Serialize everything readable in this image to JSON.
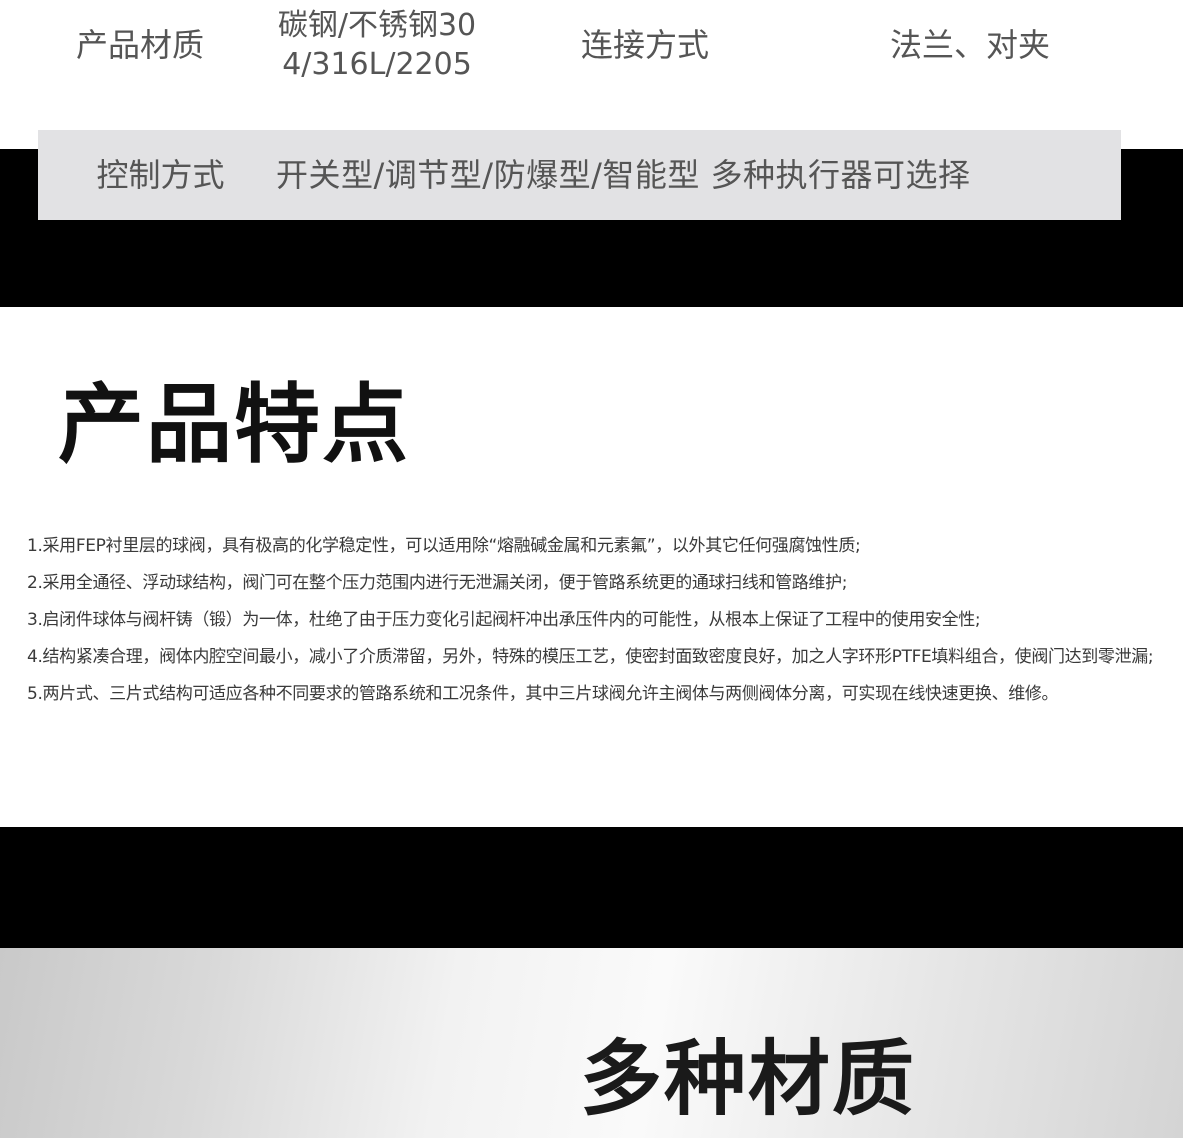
{
  "spec_table": {
    "material_label": "产品材质",
    "material_value": "碳钢/不锈钢304/316L/2205",
    "connection_label": "连接方式",
    "connection_value": "法兰、对夹",
    "control_label": "控制方式",
    "control_value": "开关型/调节型/防爆型/智能型 多种执行器可选择"
  },
  "features": {
    "title": "产品特点",
    "items": [
      "1.采用FEP衬里层的球阀，具有极高的化学稳定性，可以适用除“熔融碱金属和元素氟”，以外其它任何强腐蚀性质;",
      "2.采用全通径、浮动球结构，阀门可在整个压力范围内进行无泄漏关闭，便于管路系统更的通球扫线和管路维护;",
      "3.启闭件球体与阀杆铸（锻）为一体，杜绝了由于压力变化引起阀杆冲出承压件内的可能性，从根本上保证了工程中的使用安全性;",
      "4.结构紧凑合理，阀体内腔空间最小，减小了介质滞留，另外，特殊的模压工艺，使密封面致密度良好，加之人字环形PTFE填料组合，使阀门达到零泄漏;",
      "5.两片式、三片式结构可适应各种不同要求的管路系统和工况条件，其中三片球阀允许主阀体与两侧阀体分离，可实现在线快速更换、维修。"
    ]
  },
  "materials": {
    "title": "多种材质"
  }
}
